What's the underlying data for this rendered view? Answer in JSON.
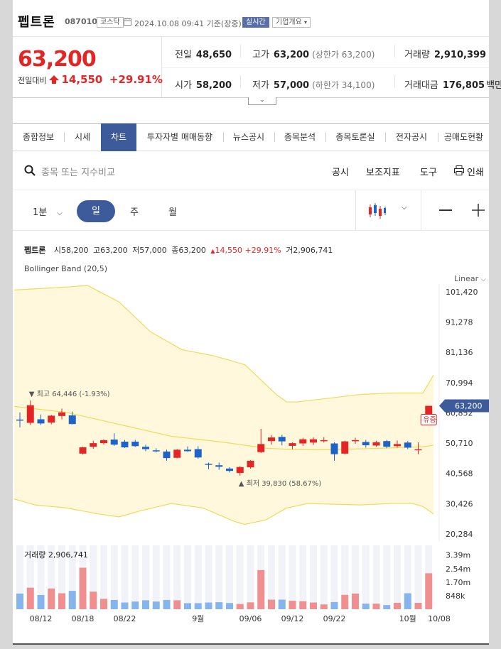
{
  "header": {
    "name": "펩트론",
    "code": "087010",
    "market": "코스닥",
    "datetime": "2024.10.08 09:41 기준(장중)",
    "realtime": "실시간",
    "company_info": "기업개요"
  },
  "price": {
    "current": "63,200",
    "change_label": "전일대비",
    "change": "14,550",
    "change_pct": "+29.91%"
  },
  "stats": {
    "prev_label": "전일",
    "prev": "48,650",
    "high_label": "고가",
    "high": "63,200",
    "high_sub": "(상한가 63,200)",
    "volume_label": "거래량",
    "volume": "2,910,399",
    "open_label": "시가",
    "open": "58,200",
    "low_label": "저가",
    "low": "57,000",
    "low_sub": "(하한가 34,100)",
    "amount_label": "거래대금",
    "amount": "176,805",
    "amount_unit": "백만"
  },
  "tabs": [
    "종합정보",
    "시세",
    "차트",
    "투자자별 매매동향",
    "뉴스공시",
    "종목분석",
    "종목토론실",
    "전자공시",
    "공매도현황"
  ],
  "search": {
    "placeholder": "종목 또는 지수비교",
    "tools": [
      "공시",
      "보조지표",
      "도구",
      "인쇄"
    ]
  },
  "periods": {
    "interval": "1분",
    "day": "일",
    "week": "주",
    "month": "월"
  },
  "chart_info": {
    "name": "펩트론",
    "open_label": "시",
    "open": "58,200",
    "high_label": "고",
    "high": "63,200",
    "low_label": "저",
    "low": "57,000",
    "close_label": "종",
    "close": "63,200",
    "change": "14,550",
    "change_pct": "+29.91%",
    "vol_label": "거",
    "vol": "2,906,741",
    "indicator": "Bollinger Band (20,5)",
    "scale": "Linear"
  },
  "colors": {
    "up": "#e22626",
    "down": "#1e64c8",
    "accent": "#3d5a9a"
  },
  "chart_data": {
    "type": "candlestick",
    "ylim": [
      20284,
      104000
    ],
    "yticks": [
      101420,
      91278,
      81136,
      70994,
      60852,
      50710,
      40568,
      30426,
      20284
    ],
    "ytick_labels": [
      "101,420",
      "91,278",
      "81,136",
      "70,994",
      "60,852",
      "50,710",
      "40,568",
      "30,426",
      "20,284"
    ],
    "x_labels": [
      {
        "i": 2,
        "label": "08/12"
      },
      {
        "i": 6,
        "label": "08/18"
      },
      {
        "i": 10,
        "label": "08/22"
      },
      {
        "i": 17,
        "label": "9월"
      },
      {
        "i": 22,
        "label": "09/06"
      },
      {
        "i": 26,
        "label": "09/12"
      },
      {
        "i": 30,
        "label": "09/22"
      },
      {
        "i": 37,
        "label": "10월"
      },
      {
        "i": 40,
        "label": "10/08"
      }
    ],
    "candles": [
      {
        "o": 58600,
        "h": 61000,
        "l": 56000,
        "c": 58300
      },
      {
        "o": 57500,
        "h": 65000,
        "l": 56800,
        "c": 63400
      },
      {
        "o": 58700,
        "h": 60300,
        "l": 56800,
        "c": 57300
      },
      {
        "o": 57600,
        "h": 60200,
        "l": 57000,
        "c": 59900
      },
      {
        "o": 59800,
        "h": 62300,
        "l": 58700,
        "c": 61000
      },
      {
        "o": 60000,
        "h": 61300,
        "l": 57000,
        "c": 57100
      },
      {
        "o": 47200,
        "h": 49500,
        "l": 46900,
        "c": 49300
      },
      {
        "o": 49500,
        "h": 51500,
        "l": 48800,
        "c": 50700
      },
      {
        "o": 50700,
        "h": 52000,
        "l": 50200,
        "c": 51700
      },
      {
        "o": 51900,
        "h": 54000,
        "l": 49800,
        "c": 50200
      },
      {
        "o": 51200,
        "h": 51800,
        "l": 49100,
        "c": 49300
      },
      {
        "o": 51200,
        "h": 51800,
        "l": 49400,
        "c": 49700
      },
      {
        "o": 49500,
        "h": 50200,
        "l": 48000,
        "c": 48700
      },
      {
        "o": 48300,
        "h": 49000,
        "l": 47600,
        "c": 48000
      },
      {
        "o": 47900,
        "h": 48500,
        "l": 44800,
        "c": 45700
      },
      {
        "o": 45800,
        "h": 48700,
        "l": 45600,
        "c": 48500
      },
      {
        "o": 48500,
        "h": 49600,
        "l": 47800,
        "c": 48000
      },
      {
        "o": 48700,
        "h": 49700,
        "l": 45500,
        "c": 45900
      },
      {
        "o": 43800,
        "h": 44200,
        "l": 42000,
        "c": 43600
      },
      {
        "o": 43300,
        "h": 44200,
        "l": 41800,
        "c": 42800
      },
      {
        "o": 42200,
        "h": 42600,
        "l": 40900,
        "c": 41400
      },
      {
        "o": 40700,
        "h": 43000,
        "l": 39830,
        "c": 42700
      },
      {
        "o": 42600,
        "h": 45000,
        "l": 42200,
        "c": 44800
      },
      {
        "o": 47700,
        "h": 55500,
        "l": 47400,
        "c": 50400
      },
      {
        "o": 51400,
        "h": 53400,
        "l": 50200,
        "c": 52600
      },
      {
        "o": 52800,
        "h": 53500,
        "l": 50000,
        "c": 51300
      },
      {
        "o": 49800,
        "h": 51000,
        "l": 48700,
        "c": 50700
      },
      {
        "o": 50600,
        "h": 52500,
        "l": 49800,
        "c": 52000
      },
      {
        "o": 50900,
        "h": 52700,
        "l": 50100,
        "c": 52000
      },
      {
        "o": 51400,
        "h": 52700,
        "l": 50900,
        "c": 51700
      },
      {
        "o": 50600,
        "h": 51000,
        "l": 44800,
        "c": 47000
      },
      {
        "o": 47200,
        "h": 51500,
        "l": 46900,
        "c": 51300
      },
      {
        "o": 51500,
        "h": 52500,
        "l": 50500,
        "c": 51700
      },
      {
        "o": 51100,
        "h": 51800,
        "l": 49200,
        "c": 50000
      },
      {
        "o": 49900,
        "h": 51500,
        "l": 49500,
        "c": 51000
      },
      {
        "o": 51400,
        "h": 51800,
        "l": 49000,
        "c": 49500
      },
      {
        "o": 49700,
        "h": 51600,
        "l": 49200,
        "c": 50400
      },
      {
        "o": 50900,
        "h": 51400,
        "l": 48700,
        "c": 49200
      },
      {
        "o": 48650,
        "h": 51000,
        "l": 47000,
        "c": 48650
      },
      {
        "o": 58200,
        "h": 63200,
        "l": 57000,
        "c": 63200
      }
    ],
    "bb_upper_x": [
      0,
      5,
      7,
      10,
      13,
      16,
      19,
      22,
      25,
      26,
      27,
      33,
      36,
      38,
      39,
      40
    ],
    "bb_upper": [
      102000,
      103000,
      103500,
      98000,
      88000,
      82000,
      80000,
      77000,
      67000,
      64500,
      64500,
      67000,
      67500,
      67500,
      67500,
      73500
    ],
    "bb_mid_x": [
      0,
      5,
      10,
      15,
      20,
      24,
      27,
      30,
      35,
      39,
      40
    ],
    "bb_mid": [
      63000,
      61000,
      57000,
      53000,
      51000,
      49000,
      48500,
      48500,
      49000,
      49500,
      50000
    ],
    "bb_lower_x": [
      0,
      2,
      5,
      8,
      10,
      12,
      15,
      18,
      21,
      22,
      24,
      26,
      28,
      33,
      36,
      38,
      39,
      40
    ],
    "bb_lower": [
      32000,
      30000,
      29000,
      27000,
      26000,
      28000,
      30500,
      29000,
      24500,
      23500,
      25000,
      29000,
      30500,
      30000,
      30500,
      30500,
      29500,
      27000
    ],
    "max_label": "최고 64,446 (-1.93%)",
    "min_label": "최저 39,830 (58.67%)",
    "last_label": "63,200",
    "alert": "유증",
    "volume": {
      "label": "거래량",
      "value": "2,906,741",
      "ymax": 4000000,
      "yticks": [
        3390000,
        2540000,
        1700000,
        848000
      ],
      "ytick_labels": [
        "3.39m",
        "2.54m",
        "1.70m",
        "848k"
      ],
      "values": [
        980000,
        1350000,
        890000,
        1300000,
        1000000,
        1150000,
        2600000,
        1100000,
        650000,
        580000,
        420000,
        480000,
        560000,
        480000,
        580000,
        560000,
        380000,
        380000,
        420000,
        440000,
        390000,
        330000,
        430000,
        2450000,
        600000,
        600000,
        530000,
        500000,
        420000,
        300000,
        450000,
        900000,
        980000,
        350000,
        350000,
        260000,
        400000,
        1000000,
        400000,
        2250000
      ]
    }
  }
}
